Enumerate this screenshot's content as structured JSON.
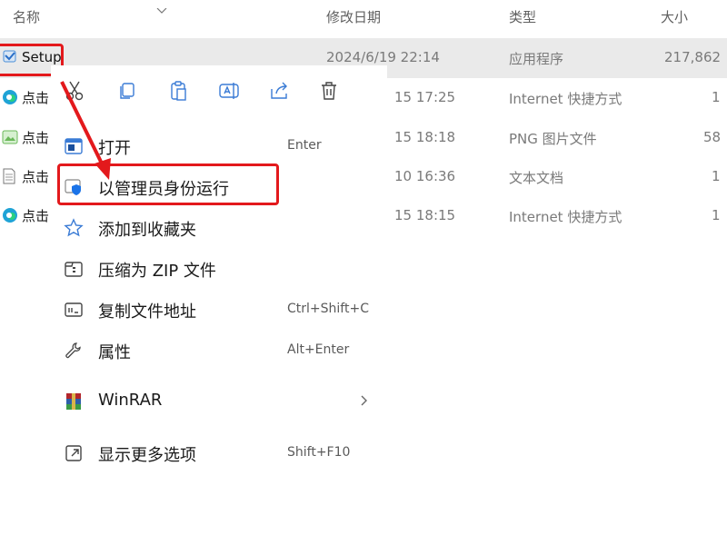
{
  "header": {
    "name": "名称",
    "date": "修改日期",
    "type": "类型",
    "size": "大小"
  },
  "files": [
    {
      "name": "Setup",
      "date": "2024/6/19 22:14",
      "type": "应用程序",
      "size": "217,862"
    },
    {
      "name": "点击",
      "date": "15 17:25",
      "type": "Internet 快捷方式",
      "size": "1"
    },
    {
      "name": "点击",
      "date": "15 18:18",
      "type": "PNG 图片文件",
      "size": "58"
    },
    {
      "name": "点击",
      "date": "10 16:36",
      "type": "文本文档",
      "size": "1"
    },
    {
      "name": "点击",
      "date": "15 18:15",
      "type": "Internet 快捷方式",
      "size": "1"
    }
  ],
  "menu": {
    "items": [
      {
        "label": "打开",
        "shortcut": "Enter",
        "icon": "open-app-icon"
      },
      {
        "label": "以管理员身份运行",
        "shortcut": "",
        "icon": "shield-icon"
      },
      {
        "label": "添加到收藏夹",
        "shortcut": "",
        "icon": "star-icon"
      },
      {
        "label": "压缩为 ZIP 文件",
        "shortcut": "",
        "icon": "zip-icon"
      },
      {
        "label": "复制文件地址",
        "shortcut": "Ctrl+Shift+C",
        "icon": "copy-path-icon"
      },
      {
        "label": "属性",
        "shortcut": "Alt+Enter",
        "icon": "wrench-icon"
      },
      {
        "label": "WinRAR",
        "shortcut": "",
        "icon": "winrar-icon"
      },
      {
        "label": "显示更多选项",
        "shortcut": "Shift+F10",
        "icon": "more-options-icon"
      }
    ],
    "toolbar": [
      "cut-icon",
      "copy-icon",
      "paste-icon",
      "rename-icon",
      "share-icon",
      "delete-icon"
    ]
  },
  "colors": {
    "highlight": "#e3191c",
    "selected_row": "#eaeaea",
    "accent": "#1a73e8"
  }
}
